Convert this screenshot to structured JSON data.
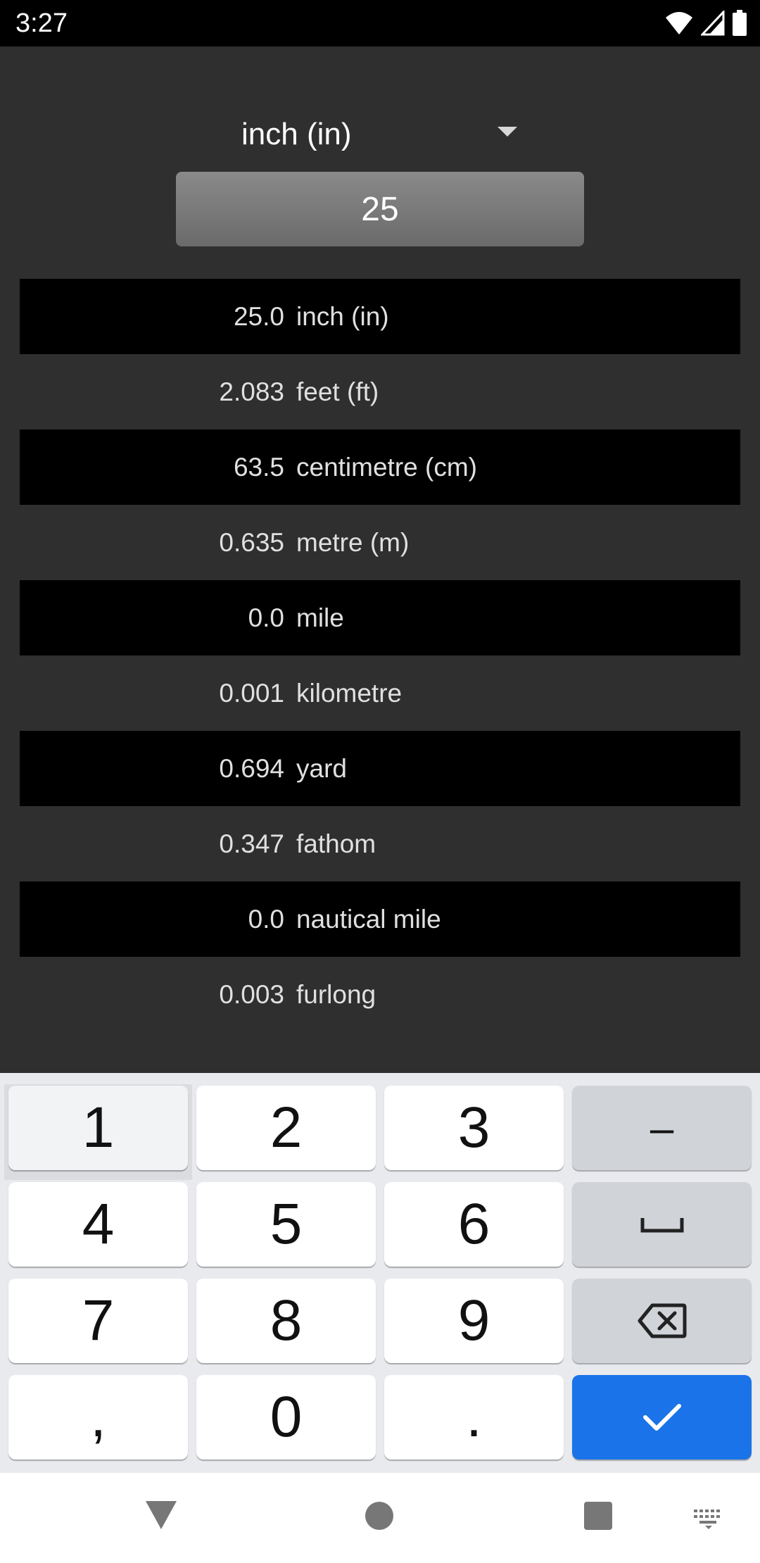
{
  "status_bar": {
    "time": "3:27",
    "icons": [
      "wifi-icon",
      "signal-icon",
      "battery-icon"
    ]
  },
  "converter": {
    "selected_unit": "inch (in)",
    "input_value": "25",
    "results": [
      {
        "value": "25.0",
        "unit": "inch (in)"
      },
      {
        "value": "2.083",
        "unit": "feet (ft)"
      },
      {
        "value": "63.5",
        "unit": "centimetre (cm)"
      },
      {
        "value": "0.635",
        "unit": "metre (m)"
      },
      {
        "value": "0.0",
        "unit": "mile"
      },
      {
        "value": "0.001",
        "unit": "kilometre"
      },
      {
        "value": "0.694",
        "unit": "yard"
      },
      {
        "value": "0.347",
        "unit": "fathom"
      },
      {
        "value": "0.0",
        "unit": "nautical mile"
      },
      {
        "value": "0.003",
        "unit": "furlong"
      }
    ]
  },
  "keyboard": {
    "keys": {
      "k1": "1",
      "k2": "2",
      "k3": "3",
      "minus": "–",
      "k4": "4",
      "k5": "5",
      "k6": "6",
      "k7": "7",
      "k8": "8",
      "k9": "9",
      "comma": ",",
      "k0": "0",
      "period": "."
    },
    "pressed_key": "1",
    "icons": [
      "space-icon",
      "backspace-icon",
      "checkmark-icon"
    ]
  },
  "nav_bar": {
    "icons": [
      "back-icon",
      "home-icon",
      "recents-icon",
      "keyboard-switch-icon"
    ]
  },
  "colors": {
    "app_background": "#2f2f2f",
    "dark_row": "#000000",
    "enter_key": "#1a73e8",
    "keyboard_background": "#e8eaed"
  }
}
